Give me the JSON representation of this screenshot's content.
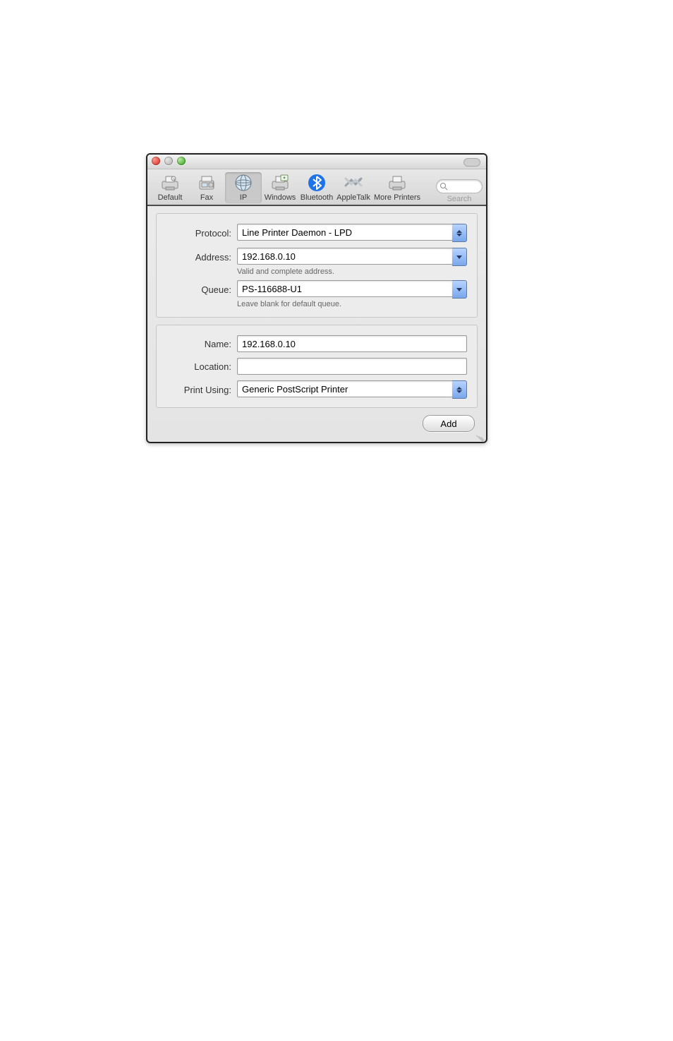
{
  "toolbar": {
    "items": [
      {
        "key": "default",
        "label": "Default"
      },
      {
        "key": "fax",
        "label": "Fax"
      },
      {
        "key": "ip",
        "label": "IP"
      },
      {
        "key": "windows",
        "label": "Windows"
      },
      {
        "key": "bluetooth",
        "label": "Bluetooth"
      },
      {
        "key": "appletalk",
        "label": "AppleTalk"
      },
      {
        "key": "more",
        "label": "More Printers"
      }
    ],
    "selected": "ip",
    "search_label": "Search",
    "search_value": ""
  },
  "form": {
    "protocol": {
      "label": "Protocol:",
      "value": "Line Printer Daemon - LPD"
    },
    "address": {
      "label": "Address:",
      "value": "192.168.0.10",
      "hint": "Valid and complete address."
    },
    "queue": {
      "label": "Queue:",
      "value": "PS-116688-U1",
      "hint": "Leave blank for default queue."
    },
    "name": {
      "label": "Name:",
      "value": "192.168.0.10"
    },
    "location": {
      "label": "Location:",
      "value": ""
    },
    "print_using": {
      "label": "Print Using:",
      "value": "Generic PostScript Printer"
    }
  },
  "footer": {
    "add": "Add"
  }
}
